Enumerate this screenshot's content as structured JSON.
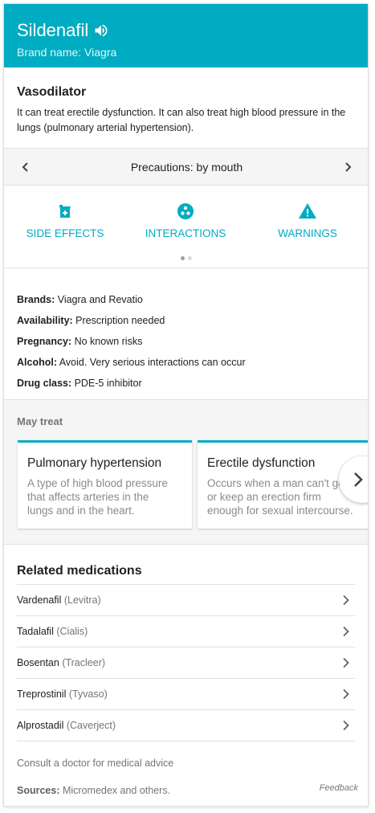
{
  "header": {
    "drug_name": "Sildenafil",
    "brand_line": "Brand name: Viagra",
    "icon": "speaker-icon",
    "color": "#00acc1"
  },
  "drug_class": {
    "title": "Vasodilator",
    "description": "It can treat erectile dysfunction. It can also treat high blood pressure in the lungs (pulmonary arterial hypertension)."
  },
  "precautions": {
    "label": "Precautions: by mouth"
  },
  "tabs": [
    {
      "label": "SIDE EFFECTS",
      "icon": "side-effects-icon"
    },
    {
      "label": "INTERACTIONS",
      "icon": "interactions-icon"
    },
    {
      "label": "WARNINGS",
      "icon": "warning-icon"
    }
  ],
  "facts": [
    {
      "key": "Brands:",
      "value": " Viagra and Revatio"
    },
    {
      "key": "Availability:",
      "value": " Prescription needed"
    },
    {
      "key": "Pregnancy:",
      "value": " No known risks"
    },
    {
      "key": "Alcohol:",
      "value": " Avoid. Very serious interactions can occur"
    },
    {
      "key": "Drug class:",
      "value": " PDE-5 inhibitor"
    }
  ],
  "may_treat": {
    "title": "May treat",
    "conditions": [
      {
        "name": "Pulmonary hypertension",
        "desc1": "A type of high blood pressure",
        "desc2": "that affects arteries in the",
        "desc3": "lungs and in the heart."
      },
      {
        "name": "Erectile dysfunction",
        "desc1": "Occurs when a man can't get",
        "desc2": "or keep an erection firm",
        "desc3": "enough for sexual intercourse."
      }
    ]
  },
  "related": {
    "title": "Related medications",
    "items": [
      {
        "name": "Vardenafil",
        "brand": "(Levitra)"
      },
      {
        "name": "Tadalafil",
        "brand": "(Cialis)"
      },
      {
        "name": "Bosentan",
        "brand": "(Tracleer)"
      },
      {
        "name": "Treprostinil",
        "brand": "(Tyvaso)"
      },
      {
        "name": "Alprostadil",
        "brand": "(Caverject)"
      }
    ]
  },
  "footer": {
    "consult": "Consult a doctor for medical advice",
    "sources_label": "Sources:",
    "sources_value": " Micromedex and others.",
    "feedback": "Feedback"
  }
}
